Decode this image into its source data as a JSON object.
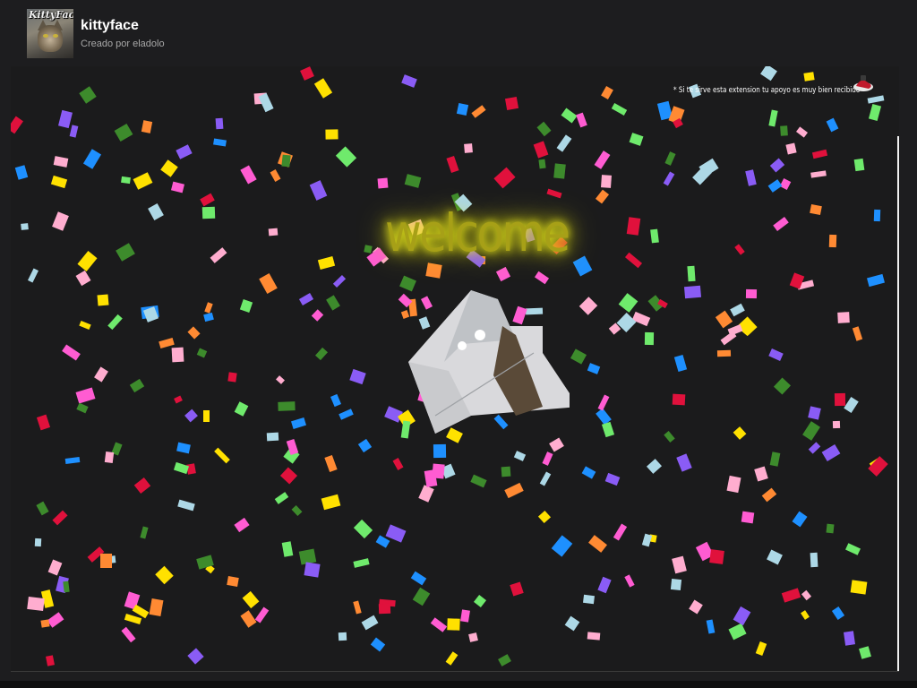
{
  "header": {
    "title": "kittyface",
    "subtitle": "Creado por eladolo",
    "avatar_logo_text": "KittyFace"
  },
  "main": {
    "welcome_text": "welcome",
    "donate_note": "* Si te sirve esta extension tu apoyo es muy bien recibido",
    "confetti_colors": [
      "#e0113c",
      "#ff5cd2",
      "#6fea6c",
      "#ff8a33",
      "#1e90ff",
      "#ffe100",
      "#8a5cf5",
      "#ffadcf",
      "#3d8b2c",
      "#add8e6"
    ]
  },
  "scrollbar": {
    "up_icon": "triangle-up-icon",
    "down_icon": "triangle-down-icon",
    "position": 0
  }
}
